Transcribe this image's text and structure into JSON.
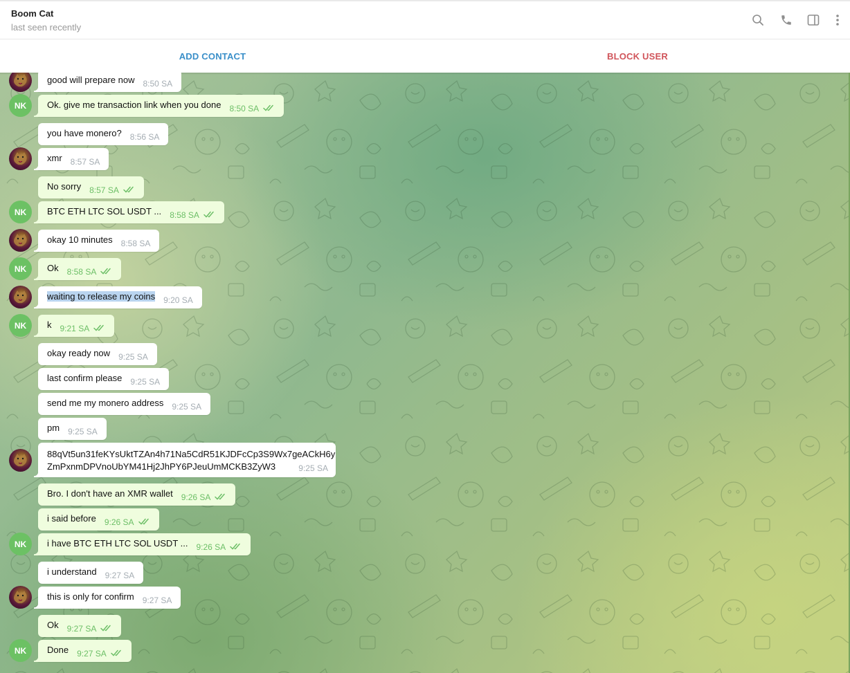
{
  "header": {
    "title": "Boom Cat",
    "status": "last seen recently",
    "icons": [
      "search-icon",
      "phone-icon",
      "sidebar-toggle-icon",
      "more-vertical-icon"
    ]
  },
  "actions": {
    "add_contact": "ADD CONTACT",
    "block_user": "BLOCK USER"
  },
  "colors": {
    "accent_blue": "#3a8fc9",
    "danger_red": "#d0545a",
    "incoming_bubble": "#ffffff",
    "outgoing_bubble": "#effdde",
    "outgoing_time": "#6dbf67",
    "nk_avatar": "#6cc164"
  },
  "me_initials": "NK",
  "messages": [
    {
      "dir": "in",
      "text": "good will prepare now",
      "time": "8:50 SA",
      "avatar": true
    },
    {
      "dir": "out",
      "text": "Ok. give me transaction link when you done",
      "time": "8:50 SA",
      "read": true,
      "avatar": true
    },
    {
      "dir": "in",
      "text": "you have monero?",
      "time": "8:56 SA",
      "avatar": false
    },
    {
      "dir": "in",
      "text": "xmr",
      "time": "8:57 SA",
      "avatar": true
    },
    {
      "dir": "out",
      "text": "No sorry",
      "time": "8:57 SA",
      "read": true,
      "avatar": false
    },
    {
      "dir": "out",
      "text": "BTC ETH LTC SOL USDT ...",
      "time": "8:58 SA",
      "read": true,
      "avatar": true
    },
    {
      "dir": "in",
      "text": "okay 10 minutes",
      "time": "8:58 SA",
      "avatar": true
    },
    {
      "dir": "out",
      "text": "Ok",
      "time": "8:58 SA",
      "read": true,
      "avatar": true
    },
    {
      "dir": "in",
      "text": "waiting to release my coins",
      "time": "9:20 SA",
      "avatar": true,
      "selected": true
    },
    {
      "dir": "out",
      "text": "k",
      "time": "9:21 SA",
      "read": true,
      "avatar": true
    },
    {
      "dir": "in",
      "text": "okay ready now",
      "time": "9:25 SA",
      "avatar": false
    },
    {
      "dir": "in",
      "text": "last confirm please",
      "time": "9:25 SA",
      "avatar": false
    },
    {
      "dir": "in",
      "text": "send me my monero address",
      "time": "9:25 SA",
      "avatar": false
    },
    {
      "dir": "in",
      "text": "pm",
      "time": "9:25 SA",
      "avatar": false
    },
    {
      "dir": "in",
      "lines": [
        "88qVt5un31feKYsUktTZAn4h71Na5CdR51KJDFcCp3S9Wx7geACkH6y",
        "ZmPxnmDPVnoUbYM41Hj2JhPY6PJeuUmMCKB3ZyW3"
      ],
      "time": "9:25 SA",
      "avatar": true
    },
    {
      "dir": "out",
      "text": "Bro. I don't have an XMR wallet",
      "time": "9:26 SA",
      "read": true,
      "avatar": false
    },
    {
      "dir": "out",
      "text": "i said before",
      "time": "9:26 SA",
      "read": true,
      "avatar": false
    },
    {
      "dir": "out",
      "text": "i have BTC ETH LTC SOL USDT ...",
      "time": "9:26 SA",
      "read": true,
      "avatar": true
    },
    {
      "dir": "in",
      "text": "i understand",
      "time": "9:27 SA",
      "avatar": false
    },
    {
      "dir": "in",
      "text": "this is only for confirm",
      "time": "9:27 SA",
      "avatar": true
    },
    {
      "dir": "out",
      "text": "Ok",
      "time": "9:27 SA",
      "read": true,
      "avatar": false
    },
    {
      "dir": "out",
      "text": "Done",
      "time": "9:27 SA",
      "read": true,
      "avatar": true
    }
  ]
}
